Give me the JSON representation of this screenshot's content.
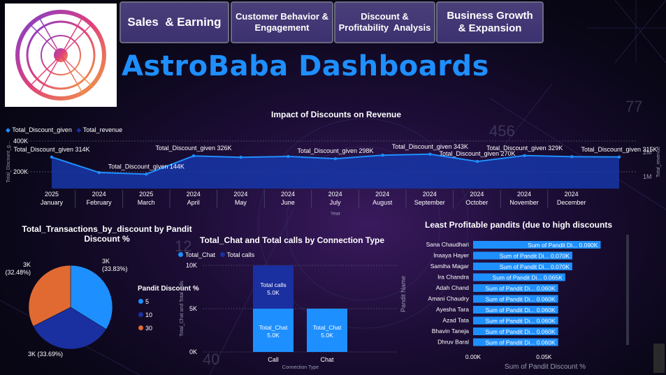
{
  "nav": [
    {
      "label": "Sales  & Earning"
    },
    {
      "label": "Customer Behavior & Engagement"
    },
    {
      "label": "Discount & Profitability  Analysis"
    },
    {
      "label": "Business Growth & Expansion"
    }
  ],
  "header": {
    "title": "AstroBaba Dashboards"
  },
  "colors": {
    "accent": "#1e8fff",
    "dark_blue": "#1a2fa0",
    "orange": "#e06a32",
    "bar_light": "#1e8fff"
  },
  "chart_data": [
    {
      "type": "area",
      "title": "Impact of Discounts on Revenue",
      "legend": [
        "Total_Discount_given",
        "Total_revenue"
      ],
      "xlabel": "Year",
      "ylabel_left": "Total_Discount_g...",
      "ylabel_right": "Total_revenue",
      "x_years": [
        "2025",
        "2024",
        "2025",
        "2024",
        "2024",
        "2024",
        "2024",
        "2024",
        "2024",
        "2024",
        "2024",
        "2024",
        "2024"
      ],
      "x_months": [
        "January",
        "February",
        "March",
        "April",
        "May",
        "June",
        "July",
        "August",
        "September",
        "October",
        "November",
        "December"
      ],
      "x_years_list": [
        "2025",
        "2024",
        "2025",
        "2024",
        "2024",
        "2024",
        "2024",
        "2024",
        "2024",
        "2024",
        "2024",
        "2024"
      ],
      "y_ticks_left": [
        "400K",
        "200K"
      ],
      "y_ticks_right": [
        "2M",
        "1M"
      ],
      "series": [
        {
          "name": "Total_Discount_given",
          "values": [
            314000,
            144000,
            144000,
            326000,
            310000,
            320000,
            298000,
            330000,
            343000,
            270000,
            329000,
            315000,
            315000
          ]
        }
      ],
      "values": [
        314,
        160,
        144,
        326,
        312,
        320,
        298,
        333,
        343,
        270,
        329,
        318,
        315
      ],
      "point_labels": [
        "Total_Discount_given 314K",
        "",
        "Total_Discount_given 144K",
        "Total_Discount_given 326K",
        "",
        "",
        "Total_Discount_given 298K",
        "",
        "Total_Discount_given 343K",
        "Total_Discount_given 270K",
        "Total_Discount_given 329K",
        "",
        "Total_Discount_given 315K"
      ],
      "ylim": [
        0,
        450
      ]
    },
    {
      "type": "pie",
      "title": "Total_Transactions_by_discount by Pandit Discount %",
      "legend_title": "Pandit Discount %",
      "slices": [
        {
          "label": "5",
          "value": 33.83,
          "text": "3K (33.83%)",
          "color": "#1e8fff"
        },
        {
          "label": "10",
          "value": 33.69,
          "text": "3K (33.69%)",
          "color": "#1a2fa0"
        },
        {
          "label": "30",
          "value": 32.48,
          "text": "3K (32.48%)",
          "color": "#e06a32"
        }
      ]
    },
    {
      "type": "bar",
      "title": "Total_Chat and Total calls by Connection Type",
      "legend": [
        "Total_Chat",
        "Total calls"
      ],
      "categories": [
        "Call",
        "Chat"
      ],
      "series": [
        {
          "name": "Total_Chat",
          "values": [
            5000,
            5000
          ],
          "labels": [
            "Total_Chat 5.0K",
            "Total_Chat 5.0K"
          ]
        },
        {
          "name": "Total calls",
          "values": [
            5000,
            0
          ],
          "labels": [
            "Total calls 5.0K",
            ""
          ]
        }
      ],
      "xlabel": "Connection Type",
      "ylabel": "Total_Chat and Total calls",
      "y_ticks": [
        "10K",
        "5K",
        "0K"
      ],
      "ylim": [
        0,
        10000
      ]
    },
    {
      "type": "bar",
      "title": "Least Profitable pandits (due to high discounts",
      "ylabel": "Pandit Name",
      "xlabel": "Sum of Pandit Discount %",
      "x_ticks": [
        "0.00K",
        "0.05K"
      ],
      "categories": [
        "Sana Chaudhari",
        "Inaaya Hayer",
        "Samiha Magar",
        "Ira Chandra",
        "Adah Chand",
        "Amani Chaudry",
        "Ayesha Tara",
        "Azad Tata",
        "Bhavin Taneja",
        "Dhruv Baral"
      ],
      "values": [
        0.09,
        0.07,
        0.07,
        0.065,
        0.06,
        0.06,
        0.06,
        0.06,
        0.06,
        0.06
      ],
      "labels": [
        "Sum of Pandit Di... 0.090K",
        "Sum of Pandit Di... 0.070K",
        "Sum of Pandit Di... 0.070K",
        "Sum of Pandit Di... 0.065K",
        "Sum of Pandit Di... 0.060K",
        "Sum of Pandit Di... 0.060K",
        "Sum of Pandit Di... 0.060K",
        "Sum of Pandit Di... 0.060K",
        "Sum of Pandit Di... 0.060K",
        "Sum of Pandit Di... 0.060K"
      ],
      "xlim": [
        0,
        0.1
      ]
    }
  ]
}
